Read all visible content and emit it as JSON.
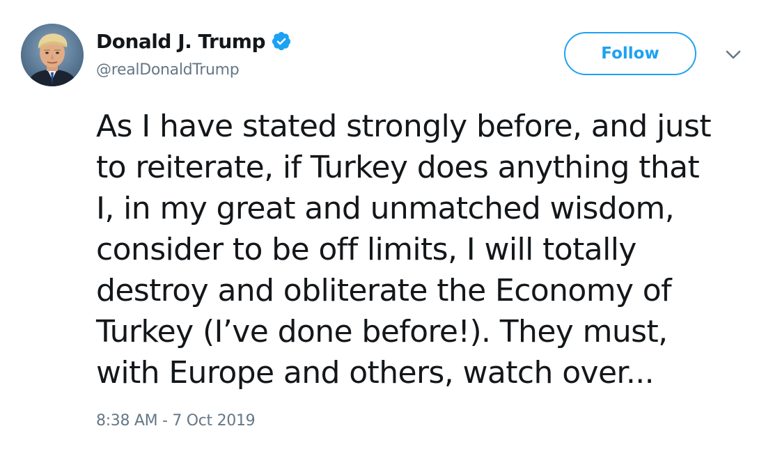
{
  "author": {
    "display_name": "Donald J. Trump",
    "handle": "@realDonaldTrump",
    "verified": true,
    "verified_icon": "verified-badge-icon",
    "avatar_icon": "profile-photo"
  },
  "actions": {
    "follow_label": "Follow",
    "more_icon": "chevron-down-icon"
  },
  "tweet": {
    "lines": [
      "As I have stated strongly before, and just",
      "to reiterate, if Turkey does anything that",
      "I, in my great and unmatched wisdom,",
      "consider to be off limits, I will totally",
      "destroy and obliterate the Economy of",
      "Turkey (I’ve done before!). They must,",
      "with Europe and others, watch over..."
    ],
    "timestamp": "8:38 AM - 7 Oct 2019"
  },
  "colors": {
    "accent": "#1da1f2",
    "text": "#14171a",
    "secondary_text": "#657786",
    "background": "#ffffff"
  }
}
